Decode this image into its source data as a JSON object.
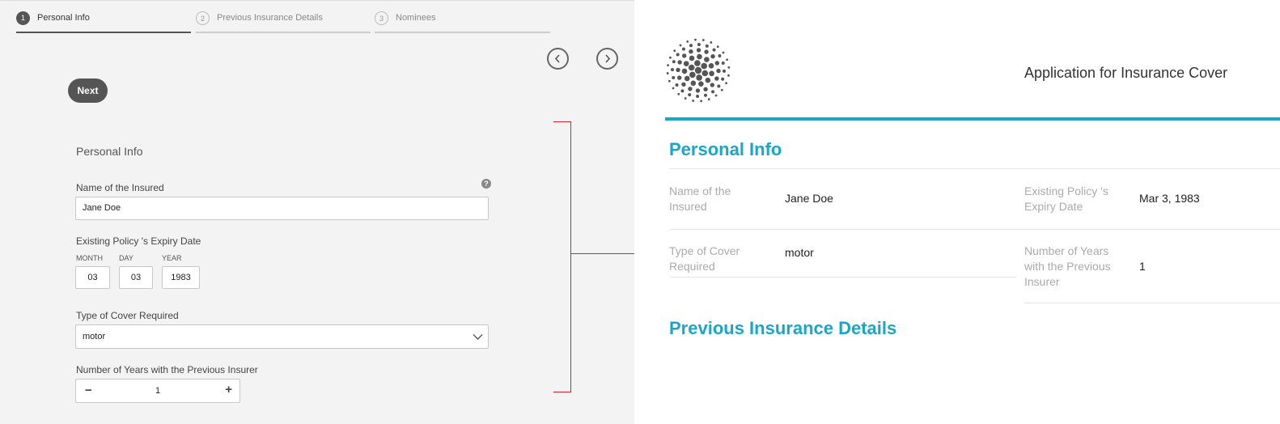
{
  "stepper": {
    "steps": [
      {
        "number": "1",
        "label": "Personal Info"
      },
      {
        "number": "2",
        "label": "Previous Insurance Details"
      },
      {
        "number": "3",
        "label": "Nominees"
      }
    ]
  },
  "nav": {
    "prev_icon": "chevron-left-icon",
    "next_icon": "chevron-right-icon"
  },
  "next_label": "Next",
  "form": {
    "section_title": "Personal Info",
    "help_glyph": "?",
    "name_label": "Name of the Insured",
    "name_value": "Jane Doe",
    "expiry_label": "Existing Policy 's Expiry Date",
    "month_label": "MONTH",
    "month_value": "03",
    "day_label": "DAY",
    "day_value": "03",
    "year_label": "YEAR",
    "year_value": "1983",
    "cover_label": "Type of Cover Required",
    "cover_value": "motor",
    "years_label": "Number of Years with the Previous Insurer",
    "years_minus": "−",
    "years_value": "1",
    "years_plus": "+"
  },
  "doc": {
    "title": "Application for Insurance Cover",
    "section1": "Personal Info",
    "name_key": "Name of the Insured",
    "name_val": "Jane Doe",
    "expiry_key": "Existing Policy 's Expiry Date",
    "expiry_val": "Mar 3, 1983",
    "cover_key": "Type of Cover Required",
    "cover_val": "motor",
    "years_key": "Number of Years with the Previous Insurer",
    "years_val": "1",
    "section2": "Previous Insurance Details"
  },
  "colors": {
    "accent": "#1aa6c9",
    "arrow": "#d9242f",
    "button": "#555555"
  }
}
